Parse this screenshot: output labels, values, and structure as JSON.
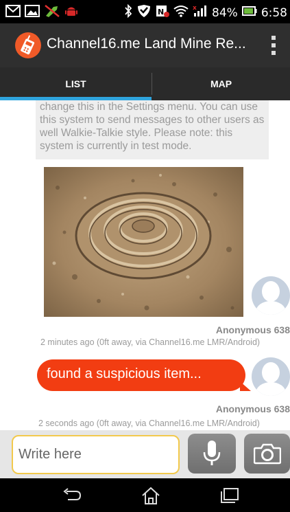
{
  "status_bar": {
    "battery_percent": "84%",
    "time": "6:58"
  },
  "action_bar": {
    "title": "Channel16.me Land Mine Re..."
  },
  "tabs": [
    {
      "label": "LIST",
      "active": true
    },
    {
      "label": "MAP",
      "active": false
    }
  ],
  "system_message": {
    "lines": [
      "change this in the Settings menu. You can use",
      "this system to send messages to other users as",
      "well Walkie-Talkie style. Please note: this",
      "system is currently in test mode."
    ]
  },
  "messages": [
    {
      "sender": "Anonymous 638",
      "meta": "2 minutes ago  (0ft away, via Channel16.me LMR/Android)"
    },
    {
      "text": "found a suspicious item...",
      "sender": "Anonymous 638",
      "meta": "2 seconds ago  (0ft away, via Channel16.me LMR/Android)"
    }
  ],
  "input": {
    "placeholder": "Write here"
  },
  "colors": {
    "accent": "#2fa4de",
    "bubble": "#f23d12",
    "input_border": "#f2c94c"
  }
}
